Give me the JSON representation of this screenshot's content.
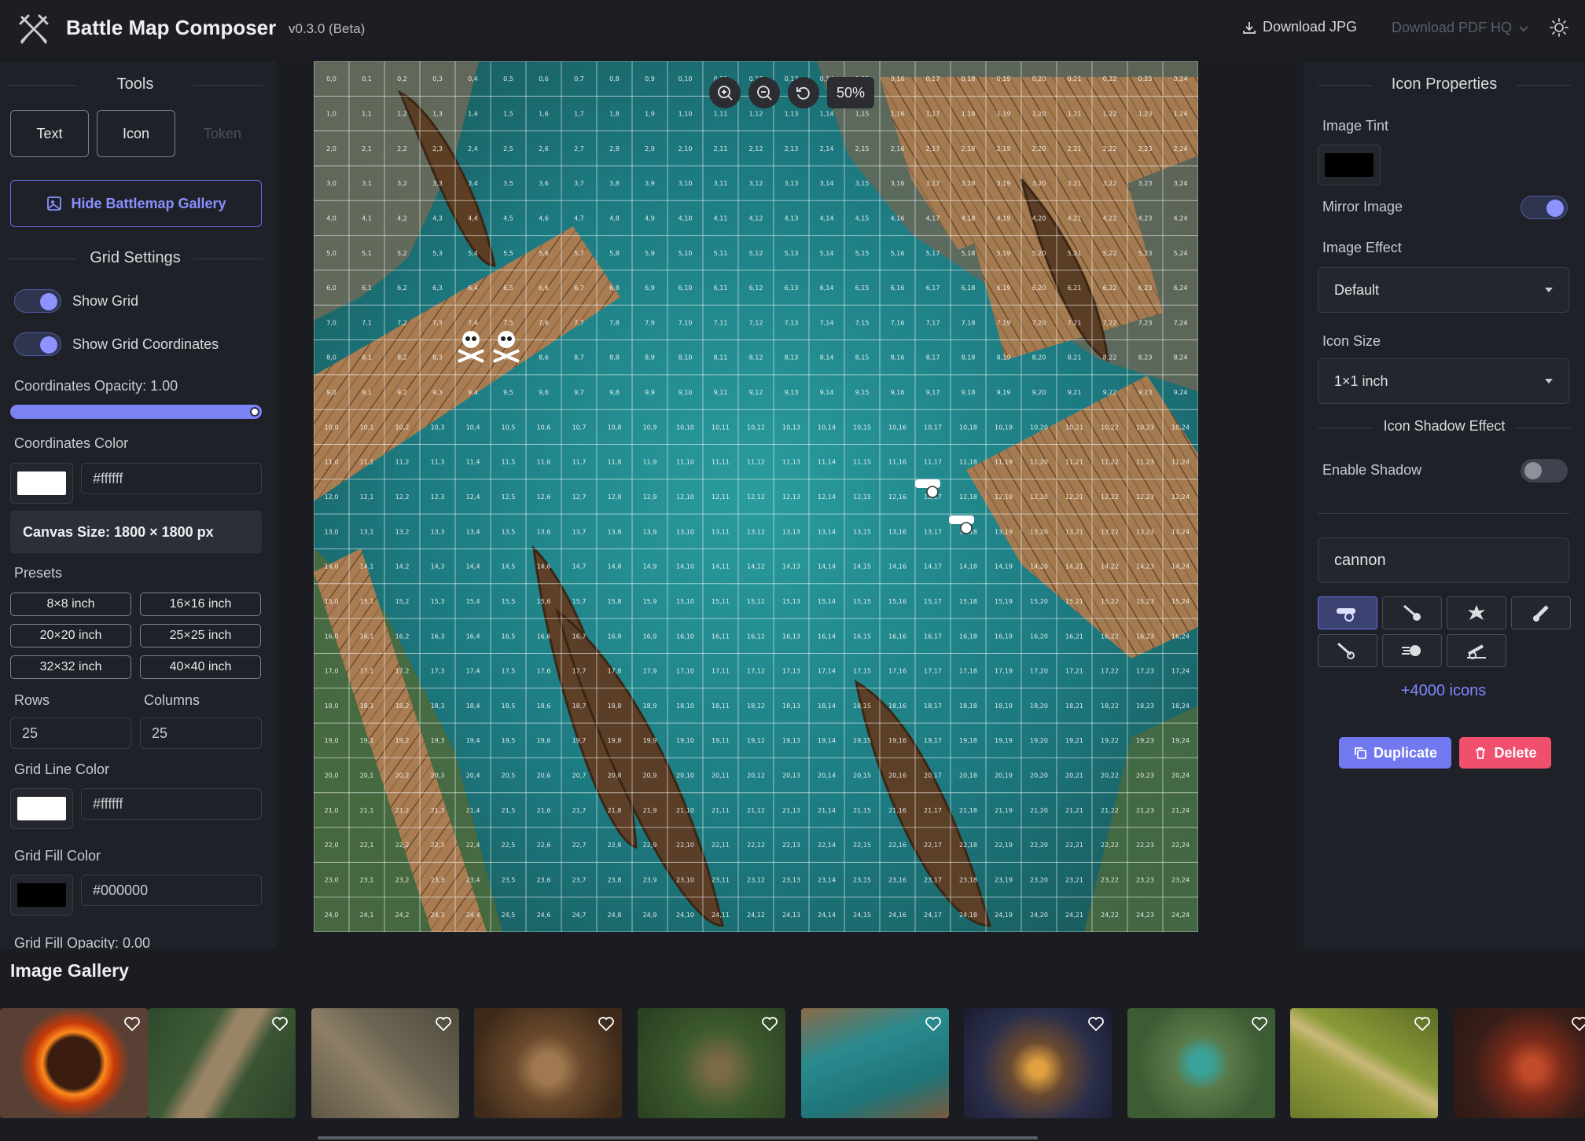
{
  "header": {
    "app_title": "Battle Map Composer",
    "version": "v0.3.0 (Beta)",
    "download_jpg": "Download JPG",
    "download_pdf": "Download PDF HQ"
  },
  "tools": {
    "title": "Tools",
    "text_label": "Text",
    "icon_label": "Icon",
    "token_label": "Token",
    "gallery_toggle_label": "Hide Battlemap Gallery"
  },
  "grid": {
    "title": "Grid Settings",
    "show_grid_label": "Show Grid",
    "show_grid": true,
    "show_coords_label": "Show Grid Coordinates",
    "show_coords": true,
    "coord_opacity_label": "Coordinates Opacity: 1.00",
    "coord_opacity": 1.0,
    "coord_color_label": "Coordinates Color",
    "coord_color": "#ffffff",
    "canvas_size": "Canvas Size: 1800 × 1800 px",
    "presets_label": "Presets",
    "presets": [
      "8×8 inch",
      "16×16 inch",
      "20×20 inch",
      "25×25 inch",
      "32×32 inch",
      "40×40 inch"
    ],
    "rows_label": "Rows",
    "rows": "25",
    "columns_label": "Columns",
    "columns": "25",
    "line_color_label": "Grid Line Color",
    "line_color": "#ffffff",
    "fill_color_label": "Grid Fill Color",
    "fill_color": "#000000",
    "fill_opacity_label": "Grid Fill Opacity: 0.00"
  },
  "map": {
    "zoom": "50%",
    "grid_rows": 25,
    "grid_cols": 25
  },
  "icon_props": {
    "title": "Icon Properties",
    "tint_label": "Image Tint",
    "tint_color": "#000000",
    "mirror_label": "Mirror Image",
    "mirror": true,
    "effect_label": "Image Effect",
    "effect_value": "Default",
    "size_label": "Icon Size",
    "size_value": "1×1 inch",
    "shadow_title": "Icon Shadow Effect",
    "shadow_label": "Enable Shadow",
    "shadow": false,
    "search_value": "cannon",
    "icons": [
      "cannon-icon",
      "cannonball-icon",
      "cannon-blast-icon",
      "mortar-icon",
      "cannon-fuse-icon",
      "cannonball-fire-icon",
      "field-cannon-icon"
    ],
    "more_icons": "+4000 icons",
    "duplicate_label": "Duplicate",
    "delete_label": "Delete"
  },
  "gallery": {
    "title": "Image Gallery",
    "thumbs": [
      "lava-ring-map",
      "forest-bridge-map",
      "ruins-crossroads-map",
      "dungeon-hall-map",
      "forest-camp-map",
      "harbor-docks-map",
      "arcane-chamber-map",
      "jungle-pool-map",
      "grassland-paths-map",
      "fire-temple-map"
    ]
  },
  "colors": {
    "accent": "#7c83f5",
    "delete": "#f0506e",
    "water": "#1f7f86",
    "wood": "#a07650"
  }
}
